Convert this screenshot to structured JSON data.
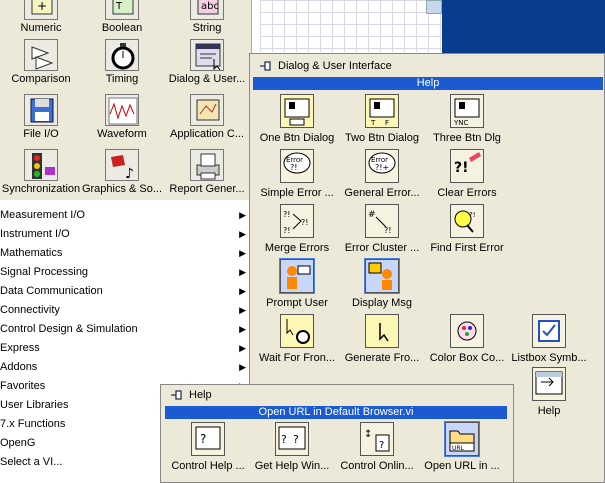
{
  "palette": {
    "items": [
      {
        "label": "Numeric",
        "icon": "numeric-icon"
      },
      {
        "label": "Boolean",
        "icon": "boolean-icon"
      },
      {
        "label": "String",
        "icon": "string-icon"
      },
      {
        "label": "Comparison",
        "icon": "comparison-icon"
      },
      {
        "label": "Timing",
        "icon": "stopwatch-icon"
      },
      {
        "label": "Dialog & User...",
        "icon": "dialog-icon"
      },
      {
        "label": "File I/O",
        "icon": "floppy-disk-icon"
      },
      {
        "label": "Waveform",
        "icon": "waveform-icon"
      },
      {
        "label": "Application C...",
        "icon": "application-control-icon"
      },
      {
        "label": "Synchronization",
        "icon": "traffic-light-icon"
      },
      {
        "label": "Graphics & So...",
        "icon": "graphics-sound-icon"
      },
      {
        "label": "Report Gener...",
        "icon": "printer-icon"
      }
    ]
  },
  "categories": [
    "Measurement I/O",
    "Instrument I/O",
    "Mathematics",
    "Signal Processing",
    "Data Communication",
    "Connectivity",
    "Control Design & Simulation",
    "Express",
    "Addons",
    "Favorites",
    "User Libraries",
    "7.x Functions",
    "OpenG",
    "Select a VI..."
  ],
  "dialog_palette": {
    "title": "Dialog & User Interface",
    "subpalette_bar": "Help",
    "items": [
      {
        "label": "One Btn Dialog",
        "icon": "one-button-dialog-icon"
      },
      {
        "label": "Two Btn Dialog",
        "icon": "two-button-dialog-icon"
      },
      {
        "label": "Three Btn Dlg",
        "icon": "three-button-dialog-icon"
      },
      {
        "label": "Simple Error ...",
        "icon": "simple-error-icon"
      },
      {
        "label": "General Error...",
        "icon": "general-error-icon"
      },
      {
        "label": "Clear Errors",
        "icon": "clear-errors-icon"
      },
      {
        "label": "Merge Errors",
        "icon": "merge-errors-icon"
      },
      {
        "label": "Error Cluster ...",
        "icon": "error-cluster-icon"
      },
      {
        "label": "Find First Error",
        "icon": "find-first-error-icon"
      },
      {
        "label": "Prompt User",
        "icon": "prompt-user-icon"
      },
      {
        "label": "Display Msg",
        "icon": "display-message-icon"
      },
      {
        "label": "Wait For Fron...",
        "icon": "wait-front-panel-icon"
      },
      {
        "label": "Generate Fro...",
        "icon": "generate-front-panel-icon"
      },
      {
        "label": "Color Box Co...",
        "icon": "color-box-icon"
      },
      {
        "label": "Listbox Symb...",
        "icon": "listbox-symbol-icon"
      },
      {
        "label": "Help",
        "icon": "help-folder-icon"
      }
    ]
  },
  "help_palette": {
    "title": "Help",
    "bar": "Open URL in Default Browser.vi",
    "items": [
      {
        "label": "Control Help ...",
        "icon": "control-help-icon"
      },
      {
        "label": "Get Help Win...",
        "icon": "get-help-window-icon"
      },
      {
        "label": "Control Onlin...",
        "icon": "control-online-help-icon"
      },
      {
        "label": "Open URL in ...",
        "icon": "open-url-icon"
      }
    ]
  }
}
